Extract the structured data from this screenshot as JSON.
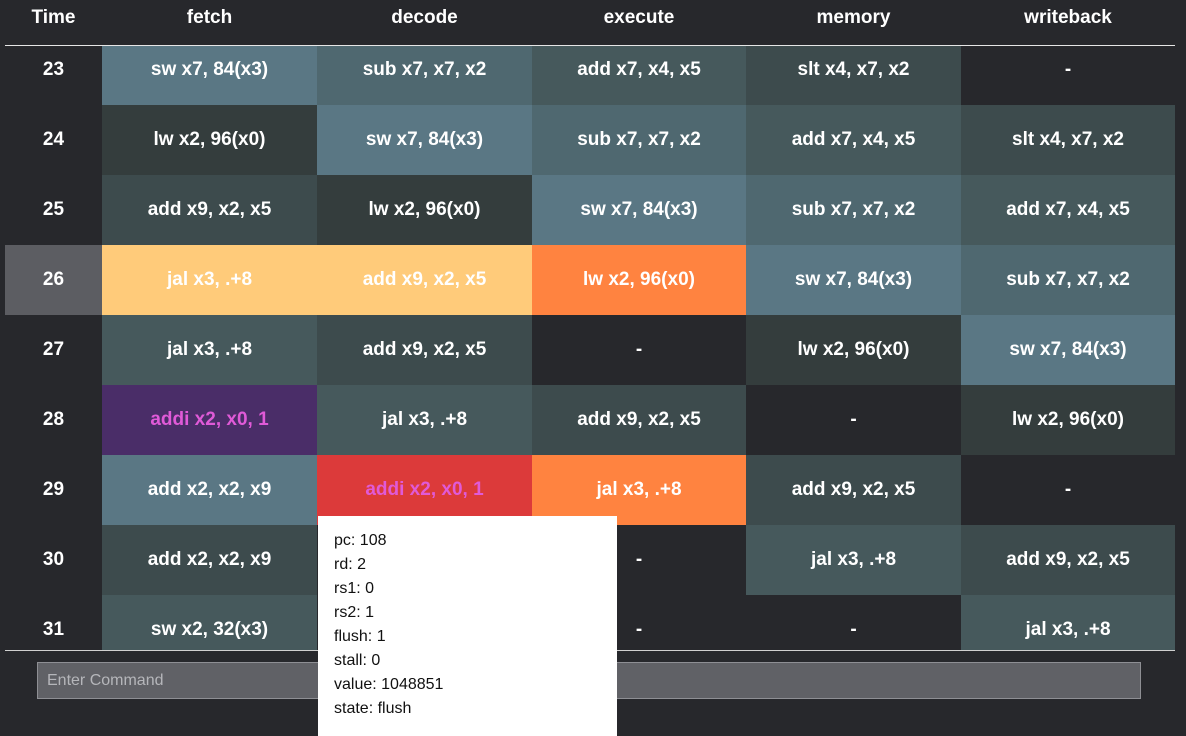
{
  "header": {
    "columns": [
      "Time",
      "fetch",
      "decode",
      "execute",
      "memory",
      "writeback"
    ]
  },
  "colors": {
    "background": "#27282c",
    "highlight_time": "#5c5d62",
    "yellow": "#ffcb7a",
    "orange": "#ff8340",
    "red": "#dc3a3a",
    "purple": "#4a2d68",
    "flush_text": "#e05ad8"
  },
  "rows": [
    {
      "time": "23",
      "cells": [
        {
          "text": "sw x7, 84(x3)",
          "bg": "#5a7784"
        },
        {
          "text": "sub x7, x7, x2",
          "bg": "#4f6870"
        },
        {
          "text": "add x7, x4, x5",
          "bg": "#46595c"
        },
        {
          "text": "slt x4, x7, x2",
          "bg": "#3d4b4d"
        },
        {
          "text": "-",
          "bg": "#27282c"
        }
      ]
    },
    {
      "time": "24",
      "cells": [
        {
          "text": "lw x2, 96(x0)",
          "bg": "#343d3d"
        },
        {
          "text": "sw x7, 84(x3)",
          "bg": "#5a7784"
        },
        {
          "text": "sub x7, x7, x2",
          "bg": "#4f6870"
        },
        {
          "text": "add x7, x4, x5",
          "bg": "#46595c"
        },
        {
          "text": "slt x4, x7, x2",
          "bg": "#3d4b4d"
        }
      ]
    },
    {
      "time": "25",
      "cells": [
        {
          "text": "add x9, x2, x5",
          "bg": "#3d4b4d"
        },
        {
          "text": "lw x2, 96(x0)",
          "bg": "#343d3d"
        },
        {
          "text": "sw x7, 84(x3)",
          "bg": "#5a7784"
        },
        {
          "text": "sub x7, x7, x2",
          "bg": "#4f6870"
        },
        {
          "text": "add x7, x4, x5",
          "bg": "#46595c"
        }
      ]
    },
    {
      "time": "26",
      "highlight": true,
      "cells": [
        {
          "text": "jal x3, .+8",
          "bg": "#ffcb7a"
        },
        {
          "text": "add x9, x2, x5",
          "bg": "#ffcb7a"
        },
        {
          "text": "lw x2, 96(x0)",
          "bg": "#ff8340"
        },
        {
          "text": "sw x7, 84(x3)",
          "bg": "#5a7784"
        },
        {
          "text": "sub x7, x7, x2",
          "bg": "#4f6870"
        }
      ]
    },
    {
      "time": "27",
      "cells": [
        {
          "text": "jal x3, .+8",
          "bg": "#46595c"
        },
        {
          "text": "add x9, x2, x5",
          "bg": "#3d4b4d"
        },
        {
          "text": "-",
          "bg": "#27282c"
        },
        {
          "text": "lw x2, 96(x0)",
          "bg": "#343d3d"
        },
        {
          "text": "sw x7, 84(x3)",
          "bg": "#5a7784"
        }
      ]
    },
    {
      "time": "28",
      "cells": [
        {
          "text": "addi x2, x0, 1",
          "bg": "#4a2d68",
          "color": "#e05ad8"
        },
        {
          "text": "jal x3, .+8",
          "bg": "#46595c"
        },
        {
          "text": "add x9, x2, x5",
          "bg": "#3d4b4d"
        },
        {
          "text": "-",
          "bg": "#27282c"
        },
        {
          "text": "lw x2, 96(x0)",
          "bg": "#343d3d"
        }
      ]
    },
    {
      "time": "29",
      "cells": [
        {
          "text": "add x2, x2, x9",
          "bg": "#5a7784"
        },
        {
          "text": "addi x2, x0, 1",
          "bg": "#dc3a3a",
          "color": "#e05ad8"
        },
        {
          "text": "jal x3, .+8",
          "bg": "#ff8340"
        },
        {
          "text": "add x9, x2, x5",
          "bg": "#3d4b4d"
        },
        {
          "text": "-",
          "bg": "#27282c"
        }
      ]
    },
    {
      "time": "30",
      "cells": [
        {
          "text": "add x2, x2, x9",
          "bg": "#3d4b4d"
        },
        {
          "text": "",
          "bg": "#27282c"
        },
        {
          "text": "-",
          "bg": "#27282c"
        },
        {
          "text": "jal x3, .+8",
          "bg": "#46595c"
        },
        {
          "text": "add x9, x2, x5",
          "bg": "#3d4b4d"
        }
      ]
    },
    {
      "time": "31",
      "cells": [
        {
          "text": "sw x2, 32(x3)",
          "bg": "#46595c"
        },
        {
          "text": "",
          "bg": "#27282c"
        },
        {
          "text": "-",
          "bg": "#27282c"
        },
        {
          "text": "-",
          "bg": "#27282c"
        },
        {
          "text": "jal x3, .+8",
          "bg": "#46595c"
        }
      ]
    }
  ],
  "command": {
    "placeholder": "Enter Command",
    "value": ""
  },
  "tooltip": {
    "lines": [
      "pc: 108",
      "rd: 2",
      "rs1: 0",
      "rs2: 1",
      "flush: 1",
      "stall: 0",
      "value: 1048851",
      "state: flush"
    ]
  }
}
